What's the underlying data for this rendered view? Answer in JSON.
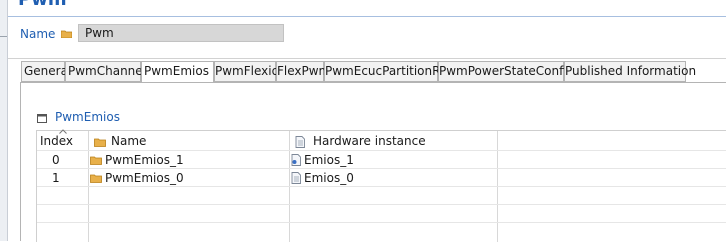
{
  "header": {
    "title": "Pwm"
  },
  "name_field": {
    "label": "Name",
    "value": "Pwm"
  },
  "tabs": [
    {
      "label": "General"
    },
    {
      "label": "PwmChannel"
    },
    {
      "label": "PwmEmios",
      "active": true
    },
    {
      "label": "PwmFlexio"
    },
    {
      "label": "FlexPwm"
    },
    {
      "label": "PwmEcucPartitionRef"
    },
    {
      "label": "PwmPowerStateConfig"
    },
    {
      "label": "Published Information"
    }
  ],
  "section": {
    "title": "PwmEmios"
  },
  "table": {
    "columns": {
      "index": "Index",
      "name": "Name",
      "hardware_instance": "Hardware instance"
    },
    "rows": [
      {
        "index": "0",
        "name": "PwmEmios_1",
        "hardware_instance": "Emios_1"
      },
      {
        "index": "1",
        "name": "PwmEmios_0",
        "hardware_instance": "Emios_0"
      }
    ]
  },
  "colors": {
    "accent": "#1f5eb1",
    "folder": "#e0a32b",
    "input_bg": "#d7d7d7"
  },
  "icons": [
    "folder-icon",
    "document-icon",
    "linked-document-icon",
    "table-section-icon",
    "sort-caret-icon"
  ]
}
